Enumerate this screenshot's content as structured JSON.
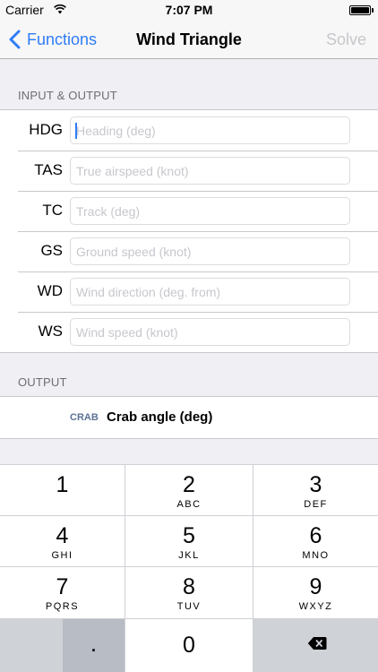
{
  "status_bar": {
    "carrier": "Carrier",
    "time": "7:07 PM"
  },
  "nav": {
    "back_label": "Functions",
    "title": "Wind Triangle",
    "solve_label": "Solve"
  },
  "input_section": {
    "header": "INPUT & OUTPUT",
    "rows": [
      {
        "label": "HDG",
        "placeholder": "Heading (deg)"
      },
      {
        "label": "TAS",
        "placeholder": "True airspeed (knot)"
      },
      {
        "label": "TC",
        "placeholder": "Track (deg)"
      },
      {
        "label": "GS",
        "placeholder": "Ground speed (knot)"
      },
      {
        "label": "WD",
        "placeholder": "Wind direction (deg. from)"
      },
      {
        "label": "WS",
        "placeholder": "Wind speed (knot)"
      }
    ]
  },
  "output_section": {
    "header": "OUTPUT",
    "tag": "CRAB",
    "label": "Crab angle (deg)"
  },
  "keypad": {
    "keys": [
      {
        "num": "1",
        "letters": ""
      },
      {
        "num": "2",
        "letters": "ABC"
      },
      {
        "num": "3",
        "letters": "DEF"
      },
      {
        "num": "4",
        "letters": "GHI"
      },
      {
        "num": "5",
        "letters": "JKL"
      },
      {
        "num": "6",
        "letters": "MNO"
      },
      {
        "num": "7",
        "letters": "PQRS"
      },
      {
        "num": "8",
        "letters": "TUV"
      },
      {
        "num": "9",
        "letters": "WXYZ"
      }
    ],
    "dot": ".",
    "zero": "0",
    "delete_icon": "backspace-icon"
  }
}
